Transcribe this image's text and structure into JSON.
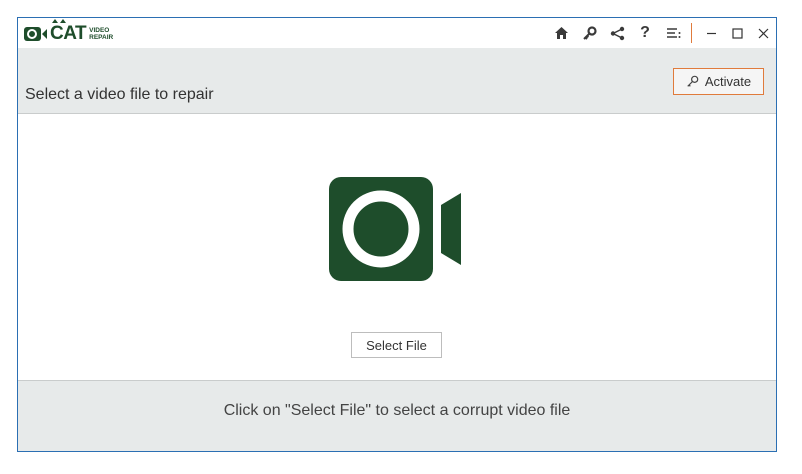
{
  "app": {
    "logo_main": "CAT",
    "logo_sub_1": "VIDEO",
    "logo_sub_2": "REPAIR"
  },
  "toolbar": {
    "icons": [
      "home-icon",
      "key-icon",
      "share-icon",
      "help-icon",
      "menu-icon"
    ],
    "help_label": "?"
  },
  "window_controls": [
    "minimize-icon",
    "maximize-icon",
    "close-icon"
  ],
  "header": {
    "title": "Select a video file to repair",
    "activate_label": "Activate"
  },
  "main": {
    "select_file_label": "Select File",
    "hero_icon": "video-camera-icon"
  },
  "footer": {
    "hint": "Click on \"Select File\" to select a corrupt video file"
  },
  "colors": {
    "brand_green": "#1e4d2b",
    "accent_orange": "#e07b3c",
    "panel_gray": "#e7eaea",
    "window_border": "#2b6fb3"
  }
}
